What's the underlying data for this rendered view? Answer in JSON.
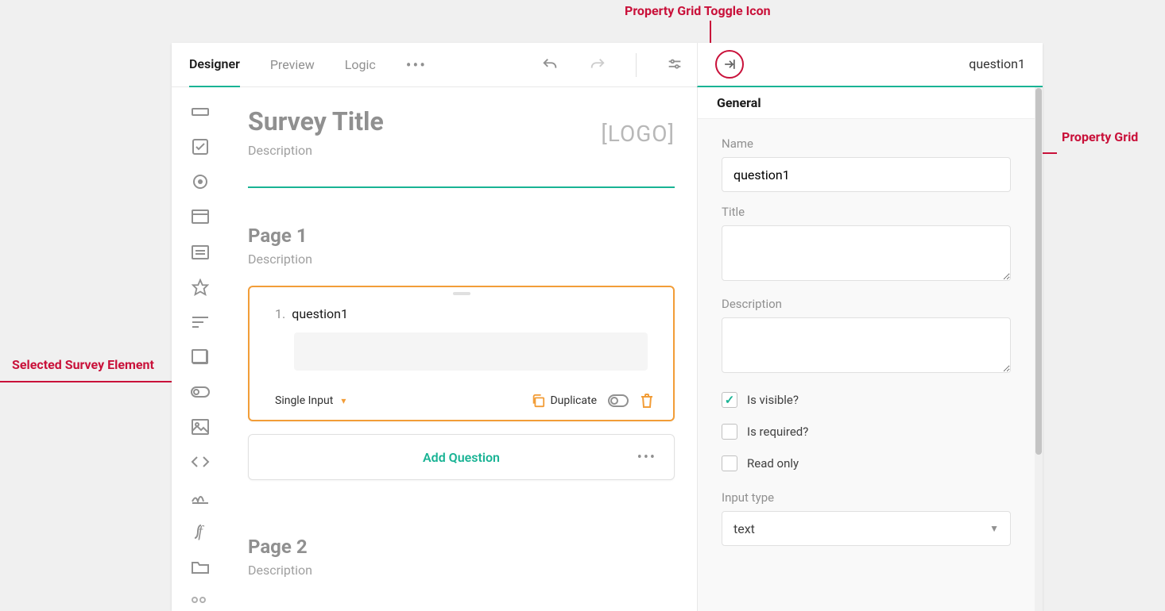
{
  "annotations": {
    "toggle": "Property Grid Toggle Icon",
    "grid": "Property Grid",
    "selected": "Selected Survey Element"
  },
  "tabs": {
    "designer": "Designer",
    "preview": "Preview",
    "logic": "Logic"
  },
  "prop_header": {
    "title": "question1"
  },
  "survey": {
    "title": "Survey Title",
    "description": "Description",
    "logo": "[LOGO]"
  },
  "page1": {
    "title": "Page 1",
    "description": "Description"
  },
  "page2": {
    "title": "Page 2",
    "description": "Description"
  },
  "question": {
    "number": "1.",
    "title": "question1",
    "type": "Single Input",
    "duplicate": "Duplicate"
  },
  "add_question": "Add Question",
  "props": {
    "section": "General",
    "name_label": "Name",
    "name_value": "question1",
    "title_label": "Title",
    "desc_label": "Description",
    "visible": "Is visible?",
    "required": "Is required?",
    "readonly": "Read only",
    "input_type_label": "Input type",
    "input_type_value": "text"
  }
}
